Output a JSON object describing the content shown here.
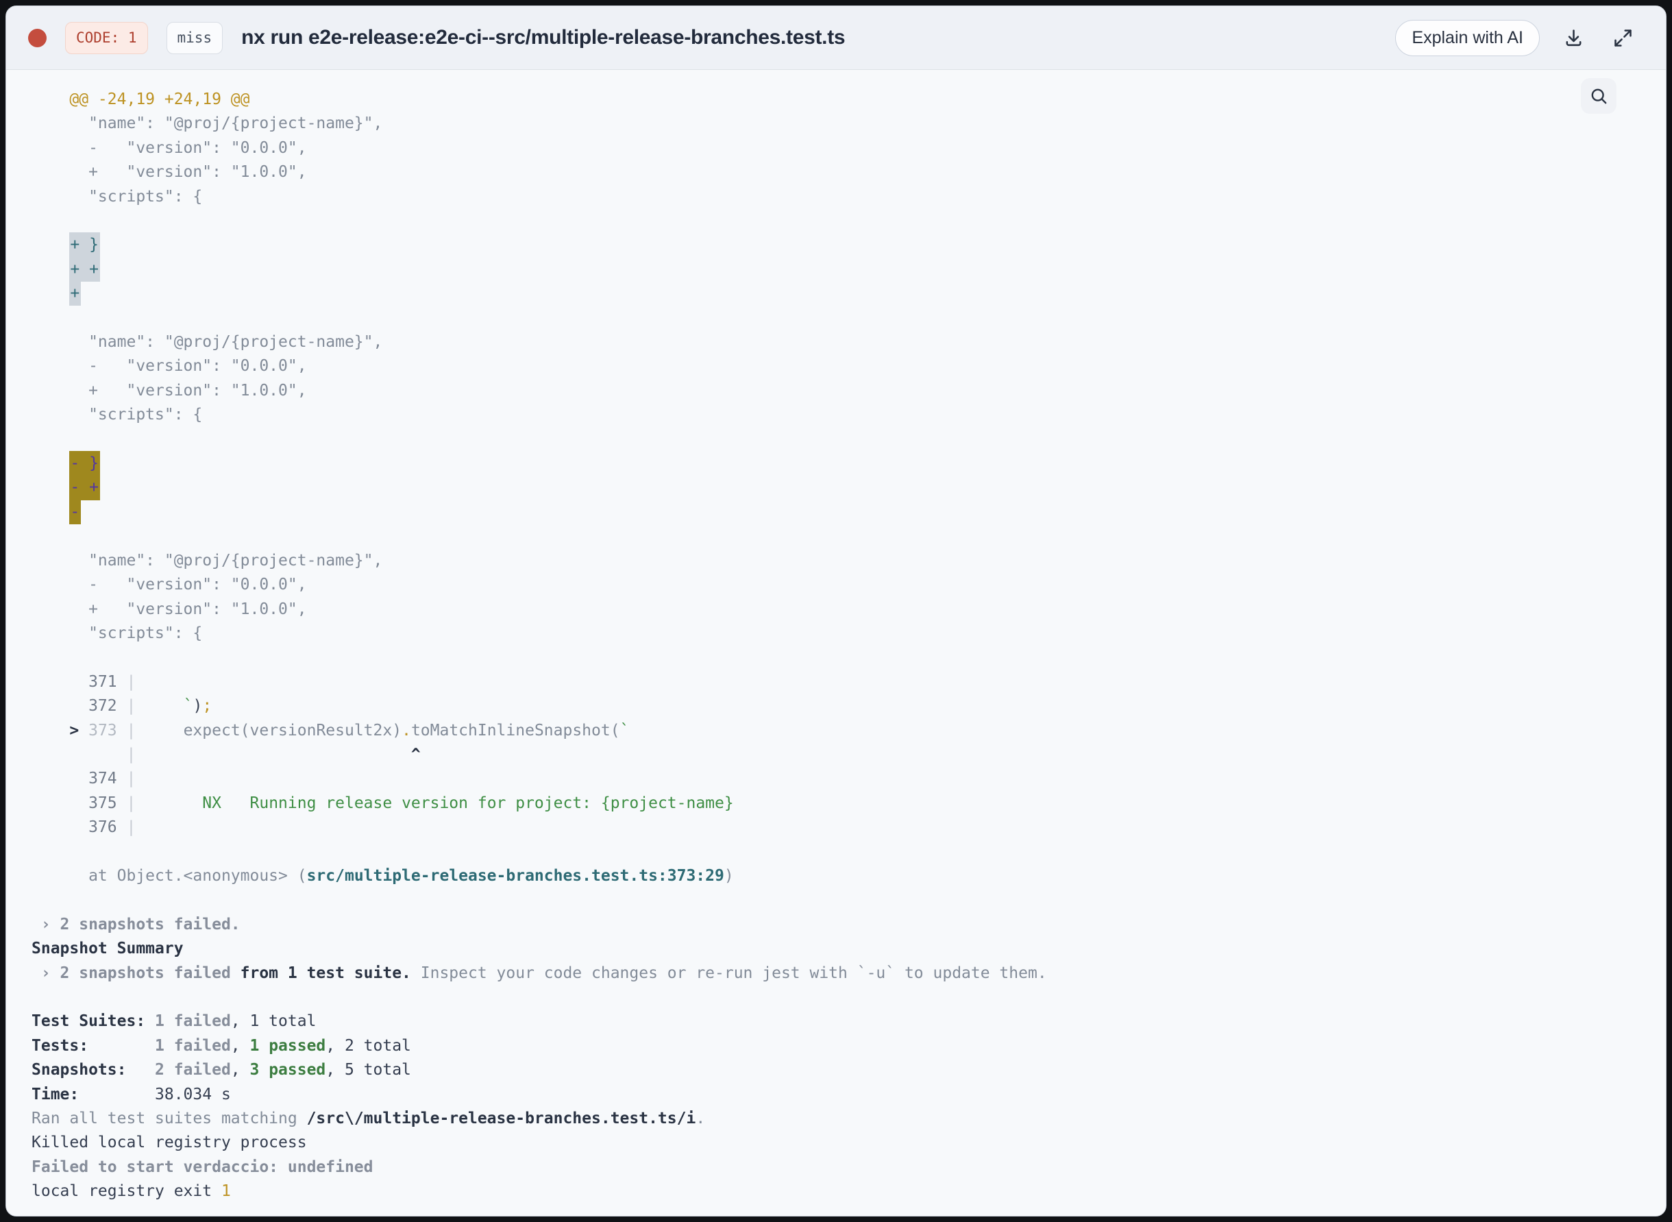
{
  "header": {
    "status_color": "#c44d3e",
    "code_badge": "CODE: 1",
    "cache_badge": "miss",
    "title": "nx run e2e-release:e2e-ci--src/multiple-release-branches.test.ts",
    "explain_button": "Explain with AI"
  },
  "colors": {
    "header_bg": "#eef1f6",
    "terminal_bg": "#f7f9fb",
    "diff_gray": "#828b98",
    "gold": "#bd9222",
    "green": "#3e8e44",
    "teal_link": "#2d6a74",
    "highlight_gray_bg": "#ced5dc",
    "highlight_gray_text": "#2e6b76",
    "highlight_gold_bg": "#9f881e",
    "highlight_gold_text": "#5336a2"
  },
  "log": {
    "lines": [
      [
        {
          "c": "y",
          "t": "    @@ -24,19 +24,19 @@"
        }
      ],
      [
        {
          "c": "g",
          "t": "      \"name\": \"@proj/{project-name}\","
        }
      ],
      [
        {
          "c": "g",
          "t": "      -   \"version\": \"0.0.0\","
        }
      ],
      [
        {
          "c": "g",
          "t": "      +   \"version\": \"1.0.0\","
        }
      ],
      [
        {
          "c": "g",
          "t": "      \"scripts\": {"
        }
      ],
      [],
      [
        {
          "c": "g",
          "t": "    "
        },
        {
          "c": "h1",
          "t": "+ }"
        }
      ],
      [
        {
          "c": "g",
          "t": "    "
        },
        {
          "c": "h1",
          "t": "+ +"
        }
      ],
      [
        {
          "c": "g",
          "t": "    "
        },
        {
          "c": "h1",
          "t": "+"
        }
      ],
      [],
      [
        {
          "c": "g",
          "t": "      \"name\": \"@proj/{project-name}\","
        }
      ],
      [
        {
          "c": "g",
          "t": "      -   \"version\": \"0.0.0\","
        }
      ],
      [
        {
          "c": "g",
          "t": "      +   \"version\": \"1.0.0\","
        }
      ],
      [
        {
          "c": "g",
          "t": "      \"scripts\": {"
        }
      ],
      [],
      [
        {
          "c": "g",
          "t": "    "
        },
        {
          "c": "h2",
          "t": "- }"
        }
      ],
      [
        {
          "c": "g",
          "t": "    "
        },
        {
          "c": "h2",
          "t": "- +"
        }
      ],
      [
        {
          "c": "g",
          "t": "    "
        },
        {
          "c": "h2",
          "t": "-"
        }
      ],
      [],
      [
        {
          "c": "g",
          "t": "      \"name\": \"@proj/{project-name}\","
        }
      ],
      [
        {
          "c": "g",
          "t": "      -   \"version\": \"0.0.0\","
        }
      ],
      [
        {
          "c": "g",
          "t": "      +   \"version\": \"1.0.0\","
        }
      ],
      [
        {
          "c": "g",
          "t": "      \"scripts\": {"
        }
      ],
      [],
      [
        {
          "c": "num",
          "t": "      371 "
        },
        {
          "c": "pipe",
          "t": "|"
        }
      ],
      [
        {
          "c": "num",
          "t": "      372 "
        },
        {
          "c": "pipe",
          "t": "|"
        },
        {
          "c": "g",
          "t": "     "
        },
        {
          "c": "gr",
          "t": "`"
        },
        {
          "c": "d",
          "t": ")"
        },
        {
          "c": "y",
          "t": ";"
        }
      ],
      [
        {
          "c": "db",
          "t": "    > "
        },
        {
          "c": "dim",
          "t": "373 "
        },
        {
          "c": "pipe",
          "t": "|"
        },
        {
          "c": "g",
          "t": "     expect(versionResult2x)"
        },
        {
          "c": "y",
          "t": "."
        },
        {
          "c": "g",
          "t": "toMatchInlineSnapshot("
        },
        {
          "c": "gr",
          "t": "`"
        }
      ],
      [
        {
          "c": "pipe",
          "t": "          |"
        },
        {
          "c": "db",
          "t": "                             ^"
        }
      ],
      [
        {
          "c": "num",
          "t": "      374 "
        },
        {
          "c": "pipe",
          "t": "|"
        }
      ],
      [
        {
          "c": "num",
          "t": "      375 "
        },
        {
          "c": "pipe",
          "t": "|"
        },
        {
          "c": "gr",
          "t": "       NX   Running release version for project: {project-name}"
        }
      ],
      [
        {
          "c": "num",
          "t": "      376 "
        },
        {
          "c": "pipe",
          "t": "|"
        }
      ],
      [],
      [
        {
          "c": "g",
          "t": "      at Object.<anonymous> ("
        },
        {
          "c": "te",
          "t": "src/multiple-release-branches.test.ts:373:29"
        },
        {
          "c": "g",
          "t": ")"
        }
      ],
      [],
      [
        {
          "c": "gb",
          "t": " › 2 snapshots failed."
        }
      ],
      [
        {
          "c": "db",
          "t": "Snapshot Summary"
        }
      ],
      [
        {
          "c": "gb",
          "t": " › 2 snapshots failed"
        },
        {
          "c": "db",
          "t": " from 1 test suite."
        },
        {
          "c": "g",
          "t": " Inspect your code changes or re-run jest with `-u` to update them."
        }
      ],
      [],
      [
        {
          "c": "db",
          "t": "Test Suites: "
        },
        {
          "c": "gb",
          "t": "1 failed"
        },
        {
          "c": "d",
          "t": ", 1 total"
        }
      ],
      [
        {
          "c": "db",
          "t": "Tests:       "
        },
        {
          "c": "gb",
          "t": "1 failed"
        },
        {
          "c": "d",
          "t": ", "
        },
        {
          "c": "grb",
          "t": "1 passed"
        },
        {
          "c": "d",
          "t": ", 2 total"
        }
      ],
      [
        {
          "c": "db",
          "t": "Snapshots:   "
        },
        {
          "c": "gb",
          "t": "2 failed"
        },
        {
          "c": "d",
          "t": ", "
        },
        {
          "c": "grb",
          "t": "3 passed"
        },
        {
          "c": "d",
          "t": ", 5 total"
        }
      ],
      [
        {
          "c": "db",
          "t": "Time:        "
        },
        {
          "c": "d",
          "t": "38.034 s"
        }
      ],
      [
        {
          "c": "g",
          "t": "Ran all test suites matching "
        },
        {
          "c": "db",
          "t": "/src\\/multiple-release-branches.test.ts/i"
        },
        {
          "c": "g",
          "t": "."
        }
      ],
      [
        {
          "c": "d",
          "t": "Killed local registry process"
        }
      ],
      [
        {
          "c": "gb",
          "t": "Failed to start verdaccio: undefined"
        }
      ],
      [
        {
          "c": "d",
          "t": "local registry exit "
        },
        {
          "c": "y",
          "t": "1"
        }
      ]
    ]
  }
}
